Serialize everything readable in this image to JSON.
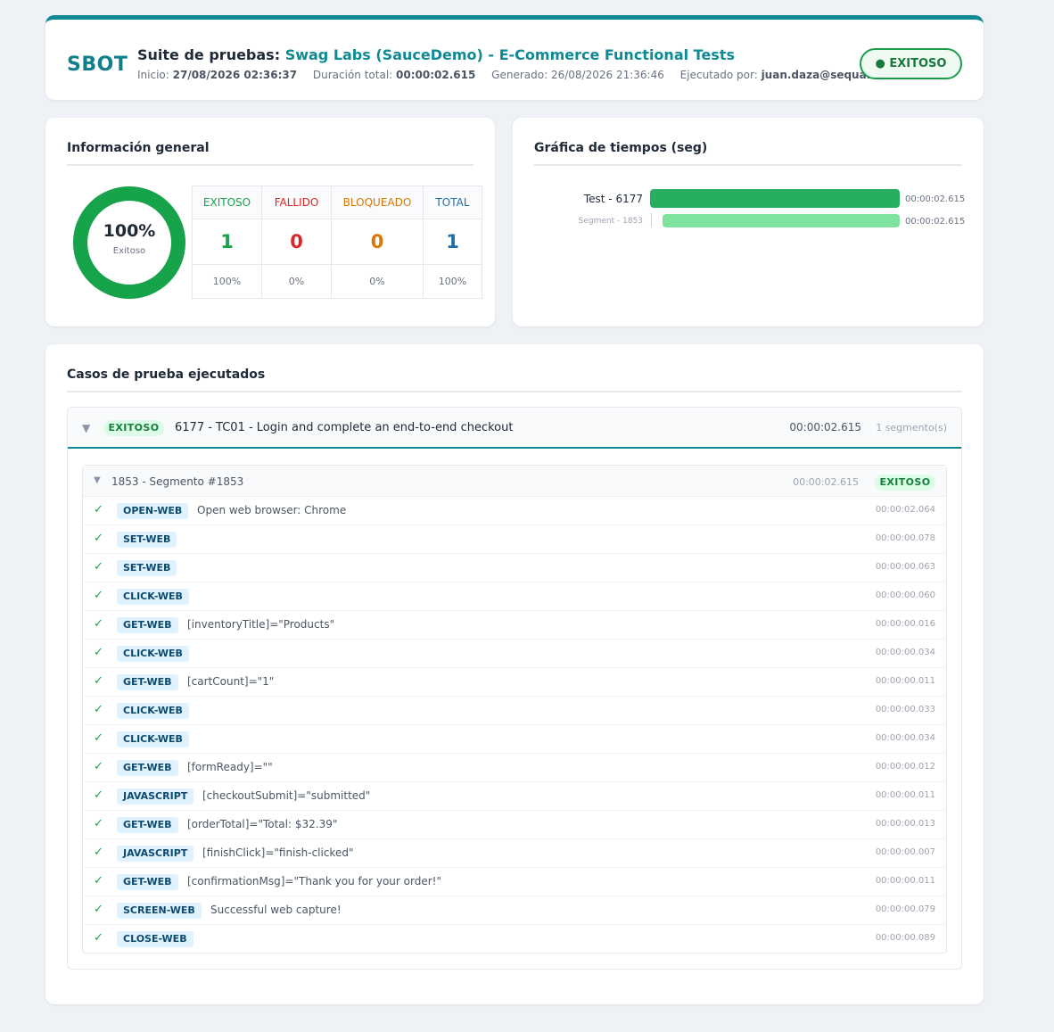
{
  "header": {
    "logo": "SBOT",
    "title_prefix": "Suite de pruebas:",
    "title_highlight": "Swag Labs (SauceDemo) - E-Commerce Functional Tests",
    "start_label": "Inicio:",
    "start_value": "27/08/2026 02:36:37",
    "duration_label": "Duración total:",
    "duration_value": "00:00:02.615",
    "generated_label": "Generado:",
    "generated_value": "26/08/2026 21:36:46",
    "executed_label": "Ejecutado por:",
    "executed_value": "juan.daza@sequal.com.co",
    "status": "● EXITOSO"
  },
  "general": {
    "title": "Información general",
    "donut_pct": "100%",
    "donut_label": "Exitoso",
    "pass_ratio": 1.0,
    "headers": [
      "EXITOSO",
      "FALLIDO",
      "BLOQUEADO",
      "TOTAL"
    ],
    "counts": [
      "1",
      "0",
      "0",
      "1"
    ],
    "percents": [
      "100%",
      "0%",
      "0%",
      "100%"
    ]
  },
  "chart": {
    "title": "Gráfica de tiempos (seg)",
    "test_label": "Test - 6177",
    "test_value": "00:00:02.615",
    "test_seconds": 2.615,
    "segment_label": "Segment - 1853",
    "segment_value": "00:00:02.615",
    "segment_seconds": 2.615
  },
  "cases": {
    "title": "Casos de prueba ejecutados",
    "case_status": "EXITOSO",
    "case_title": "6177 - TC01 - Login and complete an end-to-end checkout",
    "case_time": "00:00:02.615",
    "case_segments": "1 segmento(s)",
    "segment_title": "1853 - Segmento #1853",
    "segment_time": "00:00:02.615",
    "segment_status": "EXITOSO",
    "steps": [
      {
        "tag": "OPEN-WEB",
        "desc": "Open web browser: Chrome",
        "time": "00:00:02.064"
      },
      {
        "tag": "SET-WEB",
        "desc": "",
        "time": "00:00:00.078"
      },
      {
        "tag": "SET-WEB",
        "desc": "",
        "time": "00:00:00.063"
      },
      {
        "tag": "CLICK-WEB",
        "desc": "",
        "time": "00:00:00.060"
      },
      {
        "tag": "GET-WEB",
        "desc": "[inventoryTitle]=\"Products\"",
        "time": "00:00:00.016"
      },
      {
        "tag": "CLICK-WEB",
        "desc": "",
        "time": "00:00:00.034"
      },
      {
        "tag": "GET-WEB",
        "desc": "[cartCount]=\"1\"",
        "time": "00:00:00.011"
      },
      {
        "tag": "CLICK-WEB",
        "desc": "",
        "time": "00:00:00.033"
      },
      {
        "tag": "CLICK-WEB",
        "desc": "",
        "time": "00:00:00.034"
      },
      {
        "tag": "GET-WEB",
        "desc": "[formReady]=\"\"",
        "time": "00:00:00.012"
      },
      {
        "tag": "JAVASCRIPT",
        "desc": "[checkoutSubmit]=\"submitted\"",
        "time": "00:00:00.011"
      },
      {
        "tag": "GET-WEB",
        "desc": "[orderTotal]=\"Total: $32.39\"",
        "time": "00:00:00.013"
      },
      {
        "tag": "JAVASCRIPT",
        "desc": "[finishClick]=\"finish-clicked\"",
        "time": "00:00:00.007"
      },
      {
        "tag": "GET-WEB",
        "desc": "[confirmationMsg]=\"Thank you for your order!\"",
        "time": "00:00:00.011"
      },
      {
        "tag": "SCREEN-WEB",
        "desc": "Successful web capture!",
        "time": "00:00:00.079"
      },
      {
        "tag": "CLOSE-WEB",
        "desc": "",
        "time": "00:00:00.089"
      }
    ]
  },
  "colors": {
    "accent": "#0f8a94",
    "success": "#16a34a",
    "fail": "#dc2626",
    "blocked": "#d97706",
    "total": "#1f6fa8",
    "bar_test": "#27ae60",
    "bar_segment": "#7ee39d"
  }
}
